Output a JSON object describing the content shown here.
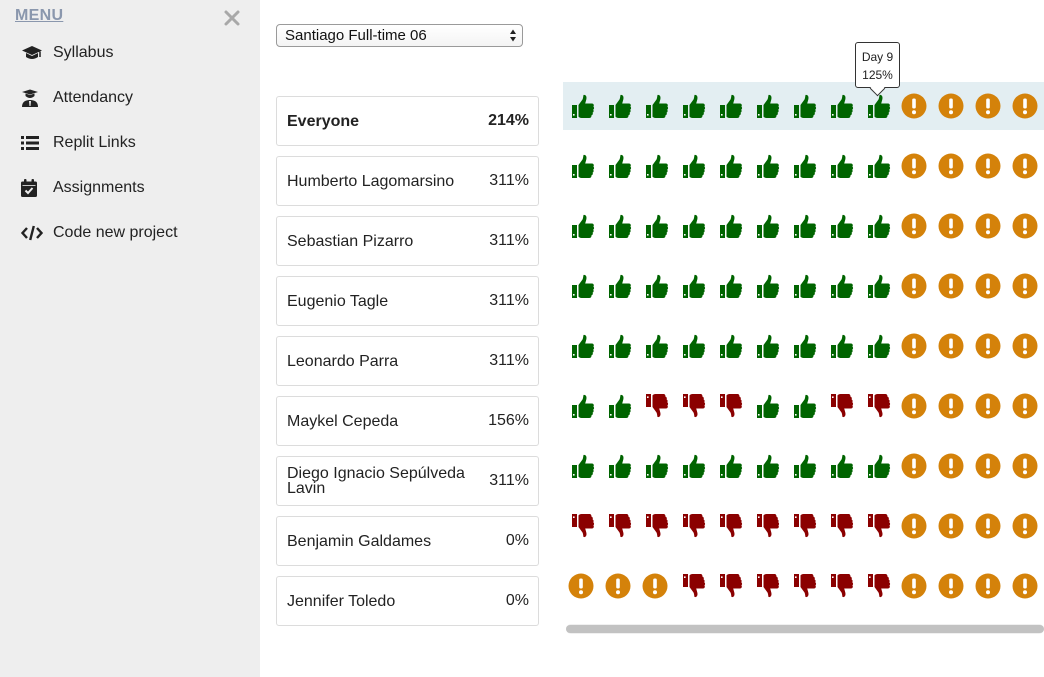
{
  "sidebar": {
    "title": "MENU",
    "close_icon": "close-icon",
    "items": [
      {
        "label": "Syllabus",
        "icon": "graduation-cap-icon"
      },
      {
        "label": "Attendancy",
        "icon": "teacher-icon"
      },
      {
        "label": "Replit Links",
        "icon": "list-icon"
      },
      {
        "label": "Assignments",
        "icon": "calendar-check-icon"
      },
      {
        "label": "Code new project",
        "icon": "code-icon"
      }
    ]
  },
  "cohort_select": {
    "value": "Santiago Full-time 06"
  },
  "students": [
    {
      "name": "Everyone",
      "percent": "214%"
    },
    {
      "name": "Humberto Lagomarsino",
      "percent": "311%"
    },
    {
      "name": "Sebastian Pizarro",
      "percent": "311%"
    },
    {
      "name": "Eugenio Tagle",
      "percent": "311%"
    },
    {
      "name": "Leonardo Parra",
      "percent": "311%"
    },
    {
      "name": "Maykel Cepeda",
      "percent": "156%"
    },
    {
      "name": "Diego Ignacio Sepúlveda Lavin",
      "percent": "311%"
    },
    {
      "name": "Benjamin Galdames",
      "percent": "0%"
    },
    {
      "name": "Jennifer Toledo",
      "percent": "0%"
    }
  ],
  "status_colors": {
    "up": "#006400",
    "down": "#8b0000",
    "pending": "#d4820a"
  },
  "grid": [
    [
      "up",
      "up",
      "up",
      "up",
      "up",
      "up",
      "up",
      "up",
      "up",
      "pending",
      "pending",
      "pending",
      "pending"
    ],
    [
      "up",
      "up",
      "up",
      "up",
      "up",
      "up",
      "up",
      "up",
      "up",
      "pending",
      "pending",
      "pending",
      "pending"
    ],
    [
      "up",
      "up",
      "up",
      "up",
      "up",
      "up",
      "up",
      "up",
      "up",
      "pending",
      "pending",
      "pending",
      "pending"
    ],
    [
      "up",
      "up",
      "up",
      "up",
      "up",
      "up",
      "up",
      "up",
      "up",
      "pending",
      "pending",
      "pending",
      "pending"
    ],
    [
      "up",
      "up",
      "up",
      "up",
      "up",
      "up",
      "up",
      "up",
      "up",
      "pending",
      "pending",
      "pending",
      "pending"
    ],
    [
      "up",
      "up",
      "down",
      "down",
      "down",
      "up",
      "up",
      "down",
      "down",
      "pending",
      "pending",
      "pending",
      "pending"
    ],
    [
      "up",
      "up",
      "up",
      "up",
      "up",
      "up",
      "up",
      "up",
      "up",
      "pending",
      "pending",
      "pending",
      "pending"
    ],
    [
      "down",
      "down",
      "down",
      "down",
      "down",
      "down",
      "down",
      "down",
      "down",
      "pending",
      "pending",
      "pending",
      "pending"
    ],
    [
      "pending",
      "pending",
      "pending",
      "down",
      "down",
      "down",
      "down",
      "down",
      "down",
      "pending",
      "pending",
      "pending",
      "pending"
    ]
  ],
  "tooltip": {
    "day": "Day 9",
    "percent": "125%"
  }
}
